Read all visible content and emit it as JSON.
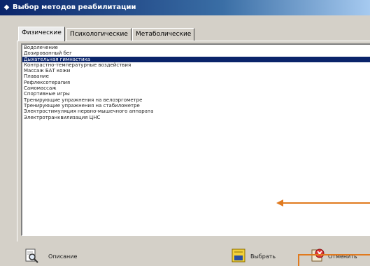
{
  "window": {
    "title": "Выбор методов реабилитации"
  },
  "tabs": [
    {
      "label": "Физические",
      "active": true
    },
    {
      "label": "Психологические",
      "active": false
    },
    {
      "label": "Метаболические",
      "active": false
    }
  ],
  "list": {
    "items": [
      "Водолечение",
      "Дозированный бег",
      "Дыхательная гимнастика",
      "Контрастно-температурные воздействия",
      "Массаж БАТ кожи",
      "Плавание",
      "Рефлексотерапия",
      "Самомассаж",
      "Спортивные игры",
      "Тренирующие упражнения на велоэргометре",
      "Тренирующие упражнения на стабилометре",
      "Электростимуляция нервно-мышечного аппарата",
      "Электротранквилизация ЦНС"
    ],
    "selected_index": 2
  },
  "buttons": {
    "describe": "Описание",
    "select": "Выбрать",
    "cancel": "Отменить"
  },
  "colors": {
    "selection": "#0a246a",
    "annotation_arrow": "#e07a1f"
  }
}
